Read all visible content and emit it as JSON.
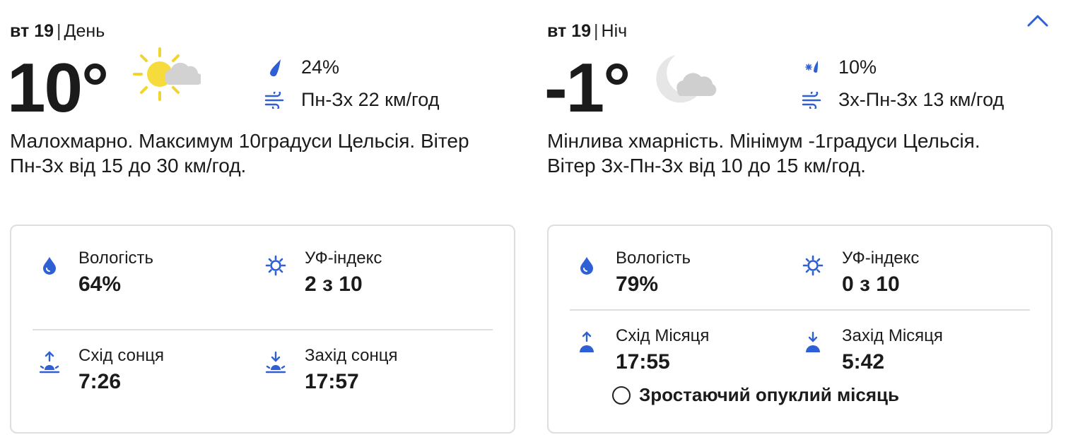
{
  "day": {
    "date": "вт 19",
    "period": "День",
    "temperature": "10°",
    "condition_icon": "sun-cloud-icon",
    "precip_icon": "raindrop-icon",
    "precip": "24%",
    "wind_icon": "wind-icon",
    "wind": "Пн-Зх 22 км/год",
    "description": "Малохмарно. Максимум 10градуси Цельсія. Вітер Пн-Зх від 15 до 30 км/год.",
    "details": {
      "humidity_label": "Вологість",
      "humidity_value": "64%",
      "uv_label": "УФ-індекс",
      "uv_value": "2 з 10",
      "sunrise_label": "Схід сонця",
      "sunrise_value": "7:26",
      "sunset_label": "Захід сонця",
      "sunset_value": "17:57"
    }
  },
  "night": {
    "date": "вт 19",
    "period": "Ніч",
    "temperature": "-1°",
    "condition_icon": "moon-cloud-icon",
    "precip_icon": "snow-rain-icon",
    "precip": "10%",
    "wind_icon": "wind-icon",
    "wind": "Зх-Пн-Зх 13 км/год",
    "description": "Мінлива хмарність. Мінімум -1градуси Цельсія. Вітер Зх-Пн-Зх від 10 до 15 км/год.",
    "details": {
      "humidity_label": "Вологість",
      "humidity_value": "79%",
      "uv_label": "УФ-індекс",
      "uv_value": "0 з 10",
      "moonrise_label": "Схід Місяця",
      "moonrise_value": "17:55",
      "moonset_label": "Захід Місяця",
      "moonset_value": "5:42",
      "moon_phase": "Зростаючий опуклий місяць"
    }
  },
  "colors": {
    "accent": "#2f5fd4",
    "text": "#1b1b1b",
    "border": "#dedede",
    "sun": "#f5dc3c",
    "cloud": "#cfcfcf"
  }
}
